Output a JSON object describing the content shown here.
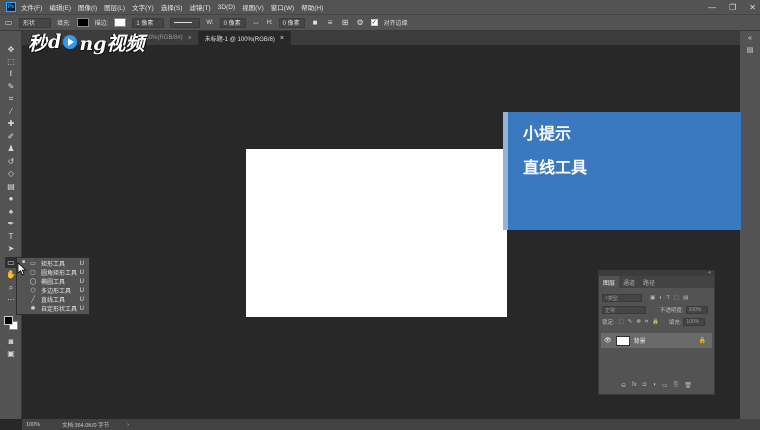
{
  "app": {
    "logo": "Ps"
  },
  "menu": [
    "文件(F)",
    "编辑(E)",
    "图像(I)",
    "图层(L)",
    "文字(Y)",
    "选择(S)",
    "滤镜(T)",
    "3D(D)",
    "视图(V)",
    "窗口(W)",
    "帮助(H)"
  ],
  "window_controls": {
    "minimize": "—",
    "restore": "❐",
    "close": "✕"
  },
  "options": {
    "mode": "形状",
    "fill_label": "填充:",
    "stroke_label": "描边:",
    "stroke_width": "1 像素",
    "w_label": "W:",
    "w_value": "0 像素",
    "h_label": "H:",
    "h_value": "0 像素",
    "align_edges_label": "对齐边缘"
  },
  "tabs": [
    {
      "label": "100%(RGB/8#)",
      "close": "×"
    },
    {
      "label": "未标题-1 @ 100%(RGB/8)",
      "close": "×"
    }
  ],
  "watermark": {
    "part1": "秒",
    "part2": "d",
    "part3": "ng视频"
  },
  "tooltip": {
    "title": "小提示",
    "body": "直线工具"
  },
  "flyout": {
    "items": [
      {
        "icon": "▭",
        "label": "矩形工具",
        "key": "U"
      },
      {
        "icon": "▢",
        "label": "圆角矩形工具",
        "key": "U"
      },
      {
        "icon": "◯",
        "label": "椭圆工具",
        "key": "U"
      },
      {
        "icon": "⬡",
        "label": "多边形工具",
        "key": "U"
      },
      {
        "icon": "╱",
        "label": "直线工具",
        "key": "U"
      },
      {
        "icon": "✱",
        "label": "自定形状工具",
        "key": "U"
      }
    ]
  },
  "layers_panel": {
    "collapse": "«",
    "tabs": [
      "图层",
      "通道",
      "路径"
    ],
    "kind_placeholder": "类型",
    "blend_mode": "正常",
    "opacity_label": "不透明度:",
    "opacity_value": "100%",
    "lock_label": "锁定:",
    "fill_label": "填充:",
    "fill_value": "100%",
    "layer_name": "背景",
    "bottom_icons": [
      "⊖",
      "fx",
      "◘",
      "◑",
      "▭",
      "⎘",
      "🗑"
    ]
  },
  "status": {
    "zoom": "100%",
    "doc": "文档:364.0K/0 字节",
    "arrow": "›"
  }
}
